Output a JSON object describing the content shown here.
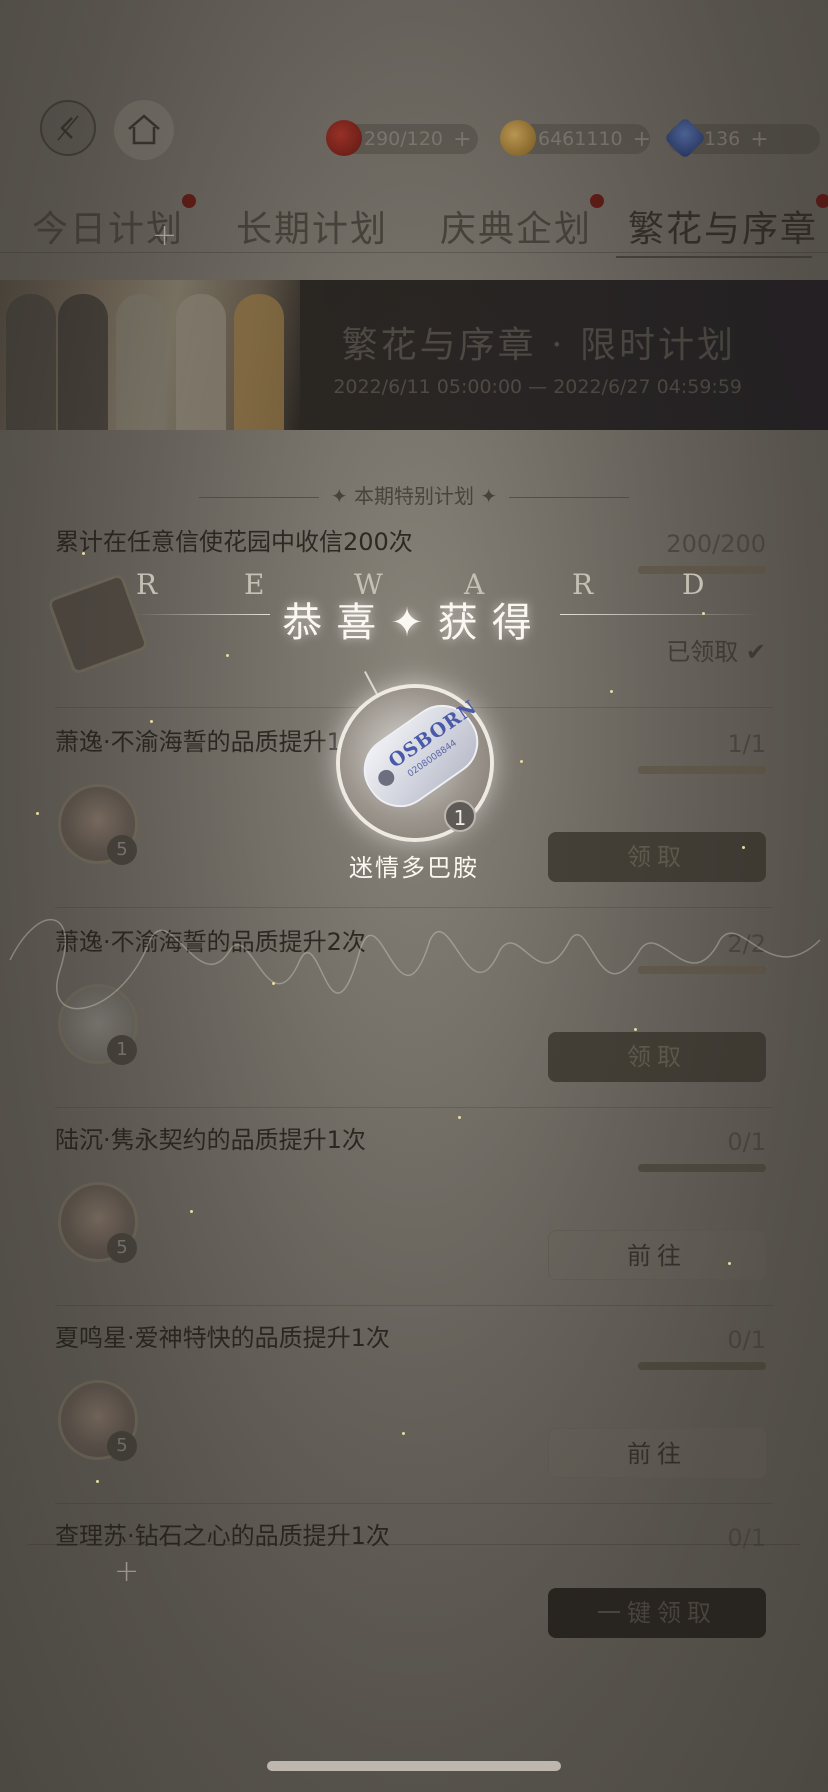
{
  "resources": {
    "apple": {
      "value": "290/120",
      "plus": "+"
    },
    "coin": {
      "value": "6461110",
      "plus": "+"
    },
    "gem": {
      "value": "136",
      "plus": "+"
    }
  },
  "tabs": [
    {
      "label": "今日计划"
    },
    {
      "label": "长期计划"
    },
    {
      "label": "庆典企划"
    },
    {
      "label": "繁花与序章"
    }
  ],
  "banner": {
    "title": "繁花与序章 · 限时计划",
    "date": "2022/6/11 05:00:00 — 2022/6/27 04:59:59"
  },
  "section_label": "本期特别计划",
  "tasks": [
    {
      "title": "累计在任意信使花园中收信200次",
      "progress": "200/200",
      "status": "已领取",
      "reward_count": ""
    },
    {
      "title": "萧逸·不渝海誓的品质提升1次",
      "progress": "1/1",
      "button": "领取",
      "reward_count": "5"
    },
    {
      "title": "萧逸·不渝海誓的品质提升2次",
      "progress": "2/2",
      "button": "领取",
      "reward_count": "1"
    },
    {
      "title": "陆沉·隽永契约的品质提升1次",
      "progress": "0/1",
      "button": "前往",
      "reward_count": "5"
    },
    {
      "title": "夏鸣星·爱神特快的品质提升1次",
      "progress": "0/1",
      "button": "前往",
      "reward_count": "5"
    },
    {
      "title": "查理苏·钻石之心的品质提升1次",
      "progress": "0/1"
    }
  ],
  "one_key_claim": "一键领取",
  "popup": {
    "reward_letters": [
      "R",
      "E",
      "W",
      "A",
      "R",
      "D"
    ],
    "congrats": "恭喜✦获得",
    "item_brand": "OSBORN",
    "item_code": "0208008844",
    "item_count": "1",
    "item_name": "迷情多巴胺"
  }
}
